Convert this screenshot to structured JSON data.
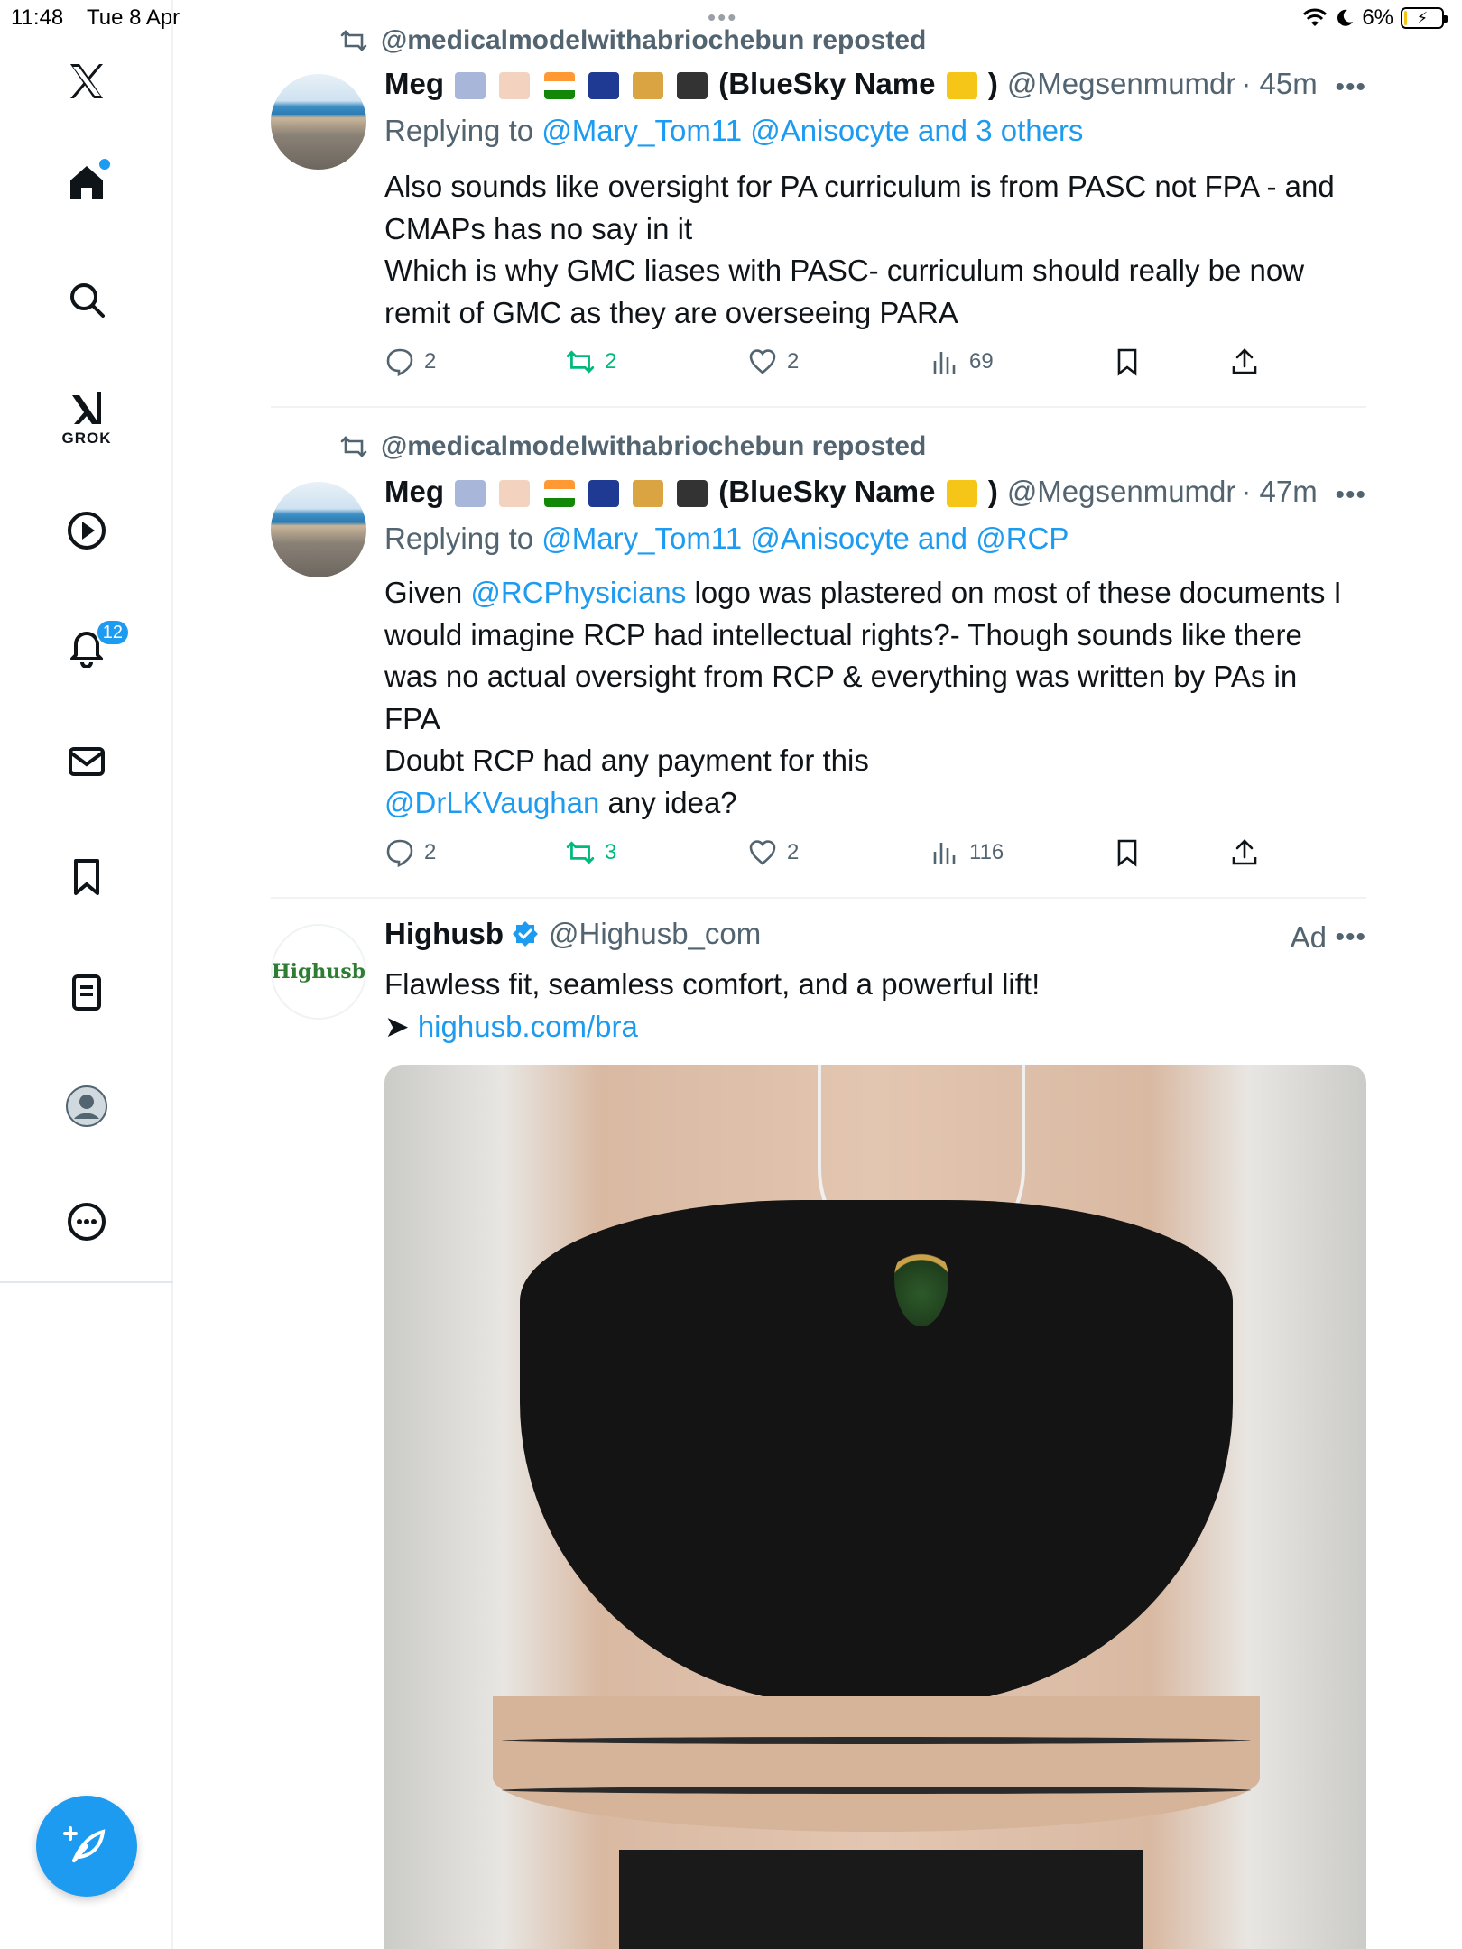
{
  "status_bar": {
    "time": "11:48",
    "date": "Tue 8 Apr",
    "battery": "6%",
    "battery_level": 0.06
  },
  "sidebar": {
    "grok_label": "GROK",
    "notifications_count": "12",
    "icons": [
      "x-logo-icon",
      "home-icon",
      "search-icon",
      "grok-icon",
      "video-icon",
      "bell-icon",
      "mail-icon",
      "bookmark-icon",
      "lists-icon",
      "profile-icon",
      "more-icon",
      "compose-icon"
    ]
  },
  "tweets": [
    {
      "repost_by": "@medicalmodelwithabriochebun reposted",
      "name_prefix": "Meg",
      "name_suffix": "(BlueSky Name",
      "name_close": ")",
      "handle": "@Megsenmumdr",
      "time": "· 45m",
      "reply_prefix": "Replying to",
      "reply_links": "@Mary_Tom11 @Anisocyte and 3 others",
      "body_lines": [
        "Also sounds like oversight for PA curriculum is from PASC not FPA - and",
        "CMAPs has no say in it",
        "Which is why GMC liases with PASC- curriculum should really be now",
        "remit of GMC as they are overseeing PARA"
      ],
      "replies": "2",
      "reposts": "2",
      "likes": "2",
      "views": "69"
    },
    {
      "repost_by": "@medicalmodelwithabriochebun reposted",
      "name_prefix": "Meg",
      "name_suffix": "(BlueSky Name",
      "name_close": ")",
      "handle": "@Megsenmumdr",
      "time": "· 47m",
      "reply_prefix": "Replying to",
      "reply_links": "@Mary_Tom11 @Anisocyte and @RCP",
      "body_line1_pre": "Given ",
      "body_line1_link": "@RCPhysicians",
      "body_line1_post": " logo was plastered on most of these documents I",
      "body_lines": [
        "would imagine RCP had intellectual rights?- Though sounds like there",
        "was no actual oversight from RCP & everything was written by PAs in",
        "FPA",
        "Doubt RCP had any payment for this"
      ],
      "body_last_link": "@DrLKVaughan",
      "body_last_post": " any idea?",
      "replies": "2",
      "reposts": "3",
      "likes": "2",
      "views": "116"
    },
    {
      "avatar_text": "Highusb",
      "name": "Highusb",
      "handle": "@Highusb_com",
      "ad_label": "Ad",
      "body_line1": "Flawless fit, seamless comfort, and a powerful lift!",
      "body_arrow": "➤ ",
      "body_link": "highusb.com/bra"
    }
  ],
  "colors": {
    "accent": "#1d9bf0",
    "repost_green": "#00ba7c",
    "muted": "#536471"
  }
}
